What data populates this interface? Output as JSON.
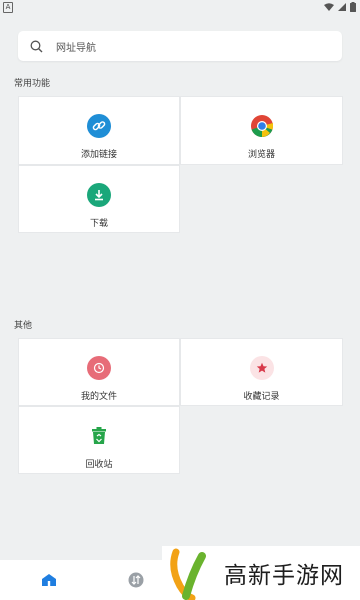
{
  "search": {
    "placeholder": "网址导航"
  },
  "sections": {
    "common": {
      "title": "常用功能",
      "items": [
        {
          "label": "添加链接",
          "icon": "link-icon",
          "color": "#1f8ed6"
        },
        {
          "label": "浏览器",
          "icon": "chrome-icon",
          "color": "#e04536"
        },
        {
          "label": "下载",
          "icon": "download-icon",
          "color": "#1aa77a"
        }
      ]
    },
    "other": {
      "title": "其他",
      "items": [
        {
          "label": "我的文件",
          "icon": "file-clock-icon",
          "color": "#e76c78"
        },
        {
          "label": "收藏记录",
          "icon": "star-icon",
          "color": "#d8394a"
        },
        {
          "label": "回收站",
          "icon": "recycle-icon",
          "color": "#26a54a"
        }
      ]
    }
  },
  "bottom_nav": {
    "tabs": [
      {
        "icon": "home-icon",
        "color": "#1f7ee0"
      },
      {
        "icon": "sort-icon",
        "color": "#9aa0a6"
      }
    ]
  },
  "watermark": {
    "text": "高新手游网"
  }
}
